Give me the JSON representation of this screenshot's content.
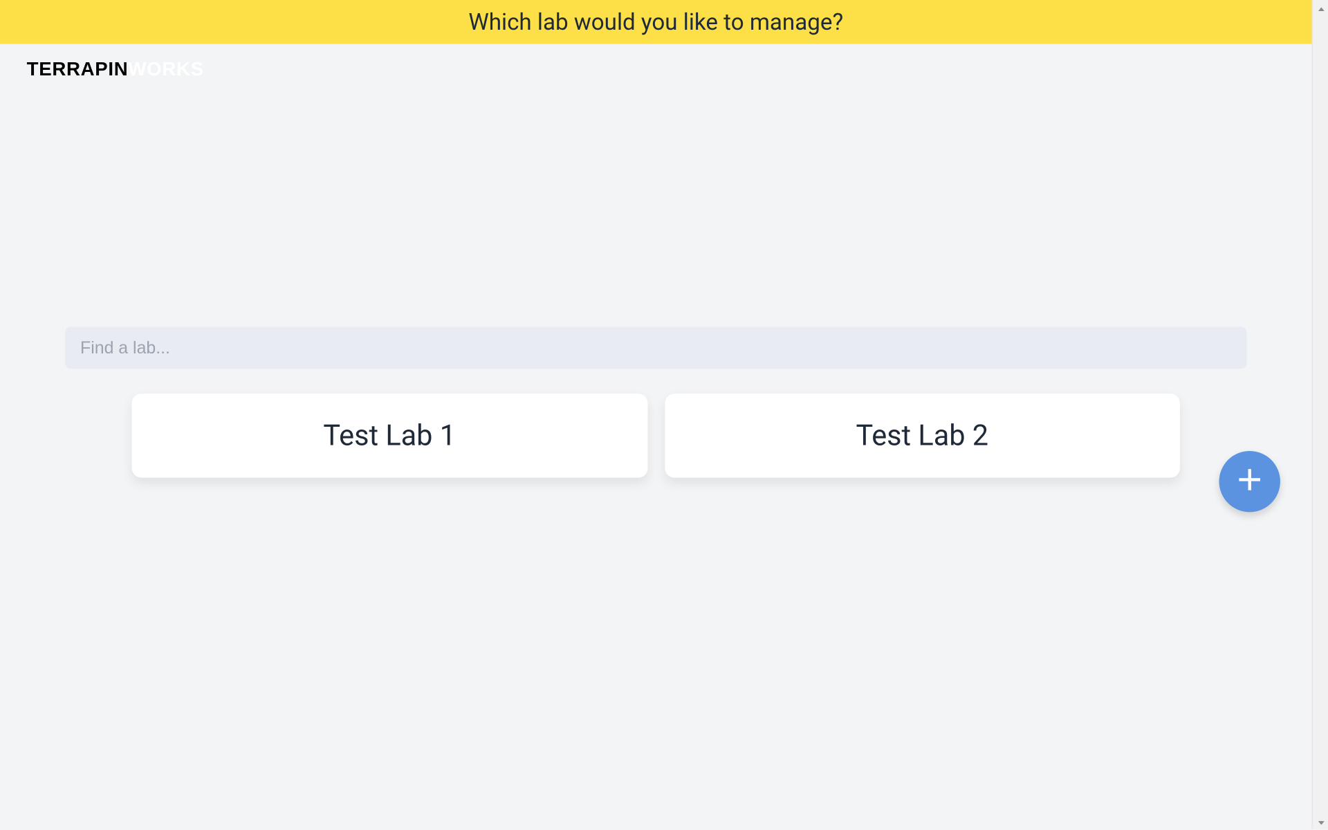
{
  "banner": {
    "title": "Which lab would you like to manage?"
  },
  "logo": {
    "part1": "TERRAPIN",
    "part2": "WORKS"
  },
  "search": {
    "placeholder": "Find a lab...",
    "value": ""
  },
  "labs": [
    {
      "name": "Test Lab 1"
    },
    {
      "name": "Test Lab 2"
    }
  ],
  "fab": {
    "icon_name": "plus-icon"
  },
  "colors": {
    "banner_bg": "#fde047",
    "fab_bg": "#5b93e0",
    "card_bg": "#ffffff",
    "search_bg": "#e8ecf2"
  }
}
